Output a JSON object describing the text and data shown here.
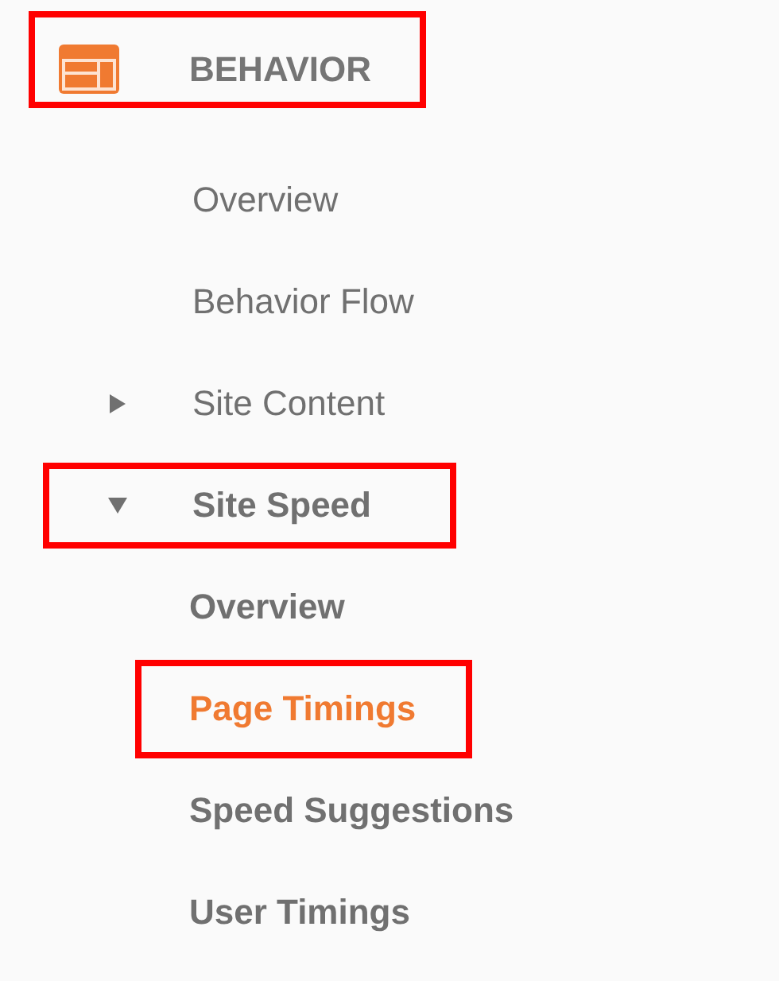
{
  "section": {
    "title": "BEHAVIOR",
    "highlighted": true,
    "items": [
      {
        "label": "Overview",
        "kind": "leaf",
        "highlighted": false,
        "selected": false
      },
      {
        "label": "Behavior Flow",
        "kind": "leaf",
        "highlighted": false,
        "selected": false
      },
      {
        "label": "Site Content",
        "kind": "folder",
        "expanded": false,
        "highlighted": false,
        "selected": false
      },
      {
        "label": "Site Speed",
        "kind": "folder",
        "expanded": true,
        "highlighted": true,
        "selected": false,
        "children": [
          {
            "label": "Overview",
            "highlighted": false,
            "selected": false
          },
          {
            "label": "Page Timings",
            "highlighted": true,
            "selected": true
          },
          {
            "label": "Speed Suggestions",
            "highlighted": false,
            "selected": false
          },
          {
            "label": "User Timings",
            "highlighted": false,
            "selected": false
          }
        ]
      }
    ]
  }
}
